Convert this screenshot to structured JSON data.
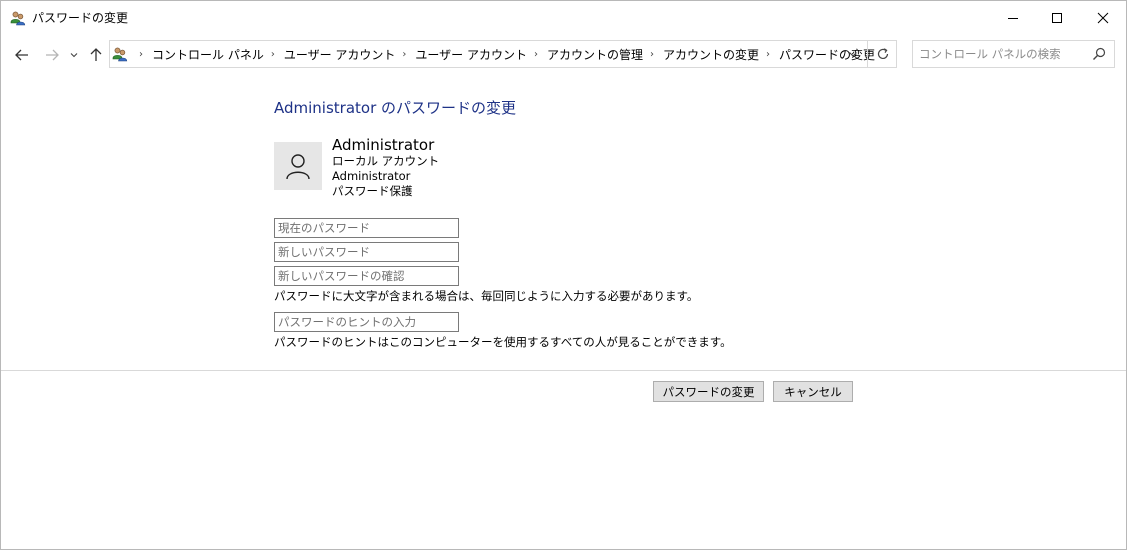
{
  "window": {
    "title": "パスワードの変更",
    "icon": "users-icon"
  },
  "address_bar": {
    "icon": "users-icon",
    "breadcrumbs": [
      "コントロール パネル",
      "ユーザー アカウント",
      "ユーザー アカウント",
      "アカウントの管理",
      "アカウントの変更",
      "パスワードの変更"
    ]
  },
  "search": {
    "placeholder": "コントロール パネルの検索"
  },
  "page": {
    "title": "Administrator のパスワードの変更"
  },
  "account": {
    "name": "Administrator",
    "type": "ローカル アカウント",
    "group": "Administrator",
    "protection": "パスワード保護"
  },
  "form": {
    "current_password_placeholder": "現在のパスワード",
    "new_password_placeholder": "新しいパスワード",
    "confirm_password_placeholder": "新しいパスワードの確認",
    "case_note": "パスワードに大文字が含まれる場合は、毎回同じように入力する必要があります。",
    "hint_placeholder": "パスワードのヒントの入力",
    "hint_note": "パスワードのヒントはこのコンピューターを使用するすべての人が見ることができます。"
  },
  "buttons": {
    "change": "パスワードの変更",
    "cancel": "キャンセル"
  },
  "colors": {
    "title_blue": "#1e3287",
    "button_face": "#e1e1e1",
    "avatar_bg": "#e6e6e6"
  }
}
